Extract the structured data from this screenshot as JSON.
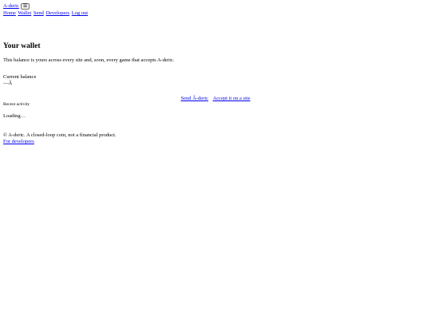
{
  "header": {
    "brand": "A-deric",
    "menu_icon_glyph": "☰",
    "nav": [
      {
        "label": "Home"
      },
      {
        "label": "Wallet"
      },
      {
        "label": "Send"
      },
      {
        "label": "Developers"
      },
      {
        "label": "Log out"
      }
    ]
  },
  "main": {
    "title": "Your wallet",
    "subtitle": "This balance is yours across every site and, soon, every game that accepts A-deric.",
    "balance_label": "Current balance",
    "balance_value": "—Ȃ",
    "actions": {
      "send": "Send Ȃ-deric",
      "accept": "Accept it on a site"
    },
    "recent_heading": "Recent activity",
    "loading": "Loading…"
  },
  "footer": {
    "notice": "© A-deric. A closed-loop coin, not a financial product.",
    "developers_link": "For developers"
  },
  "colors": {
    "link": "#0000ee",
    "text": "#000000",
    "background": "#ffffff"
  }
}
